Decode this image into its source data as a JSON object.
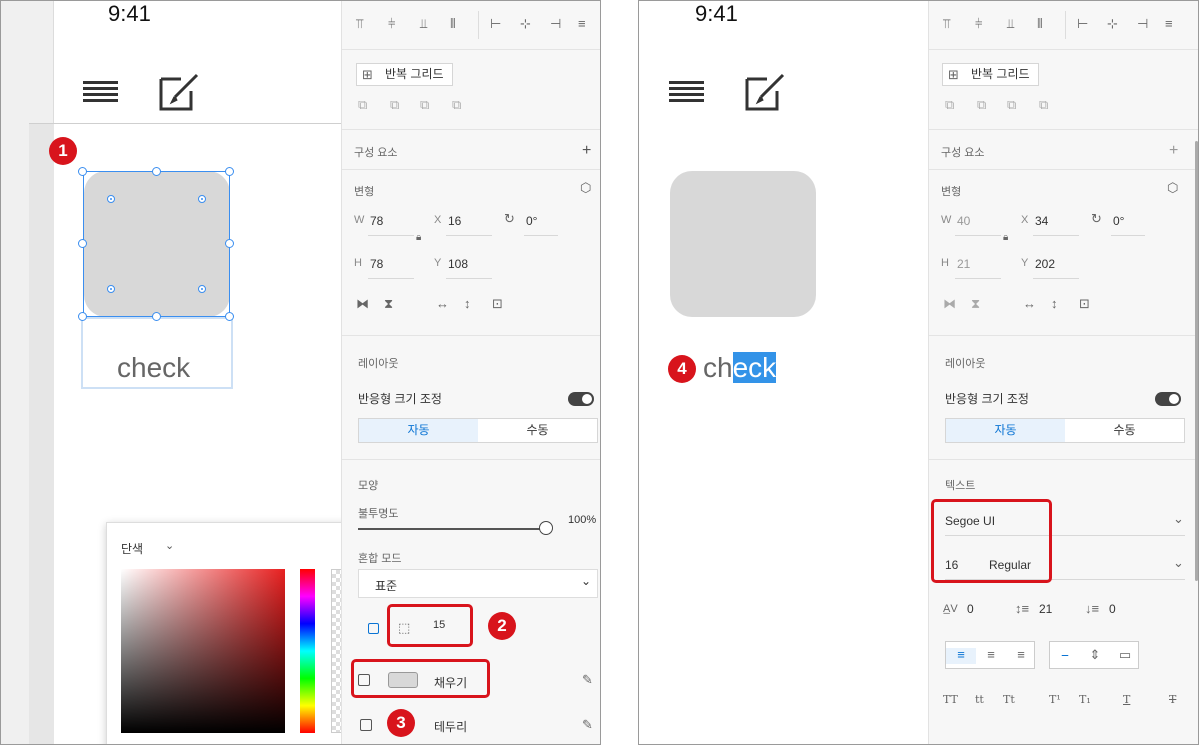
{
  "left": {
    "status_time": "9:41",
    "check_text": "check",
    "badges": {
      "one": "1",
      "two": "2",
      "three": "3"
    },
    "toolbar": {
      "repeat_grid": "반복 그리드"
    },
    "sections": {
      "components": "구성 요소",
      "transform": "변형",
      "layout": "레이아웃",
      "appearance": "모양"
    },
    "transform": {
      "w_label": "W",
      "w": "78",
      "h_label": "H",
      "h": "78",
      "x_label": "X",
      "x": "16",
      "y_label": "Y",
      "y": "108",
      "rotation": "0°"
    },
    "layout": {
      "responsive": "반응형 크기 조정",
      "auto": "자동",
      "manual": "수동"
    },
    "appearance": {
      "opacity_label": "불투명도",
      "opacity": "100%",
      "blend_label": "혼합 모드",
      "blend_value": "표준",
      "radius": "15",
      "fill": "채우기",
      "border": "테두리"
    },
    "picker": {
      "mode": "단색"
    }
  },
  "right": {
    "status_time": "9:41",
    "check_plain": "ch",
    "check_selected": "eck",
    "badge": "4",
    "toolbar": {
      "repeat_grid": "반복 그리드"
    },
    "sections": {
      "components": "구성 요소",
      "transform": "변형",
      "layout": "레이아웃",
      "text": "텍스트"
    },
    "transform": {
      "w_label": "W",
      "w": "40",
      "h_label": "H",
      "h": "21",
      "x_label": "X",
      "x": "34",
      "y_label": "Y",
      "y": "202",
      "rotation": "0°"
    },
    "layout": {
      "responsive": "반응형 크기 조정",
      "auto": "자동",
      "manual": "수동"
    },
    "text": {
      "font": "Segoe UI",
      "size": "16",
      "weight": "Regular",
      "char_spacing": "0",
      "line_spacing": "21",
      "para_spacing": "0"
    }
  },
  "colors": {
    "accent": "#0a74d4",
    "badge_red": "#d8141c",
    "selection_blue": "#3a8ef0",
    "text_select_bg": "#3393e8",
    "shape_fill": "#d8d8d8"
  }
}
